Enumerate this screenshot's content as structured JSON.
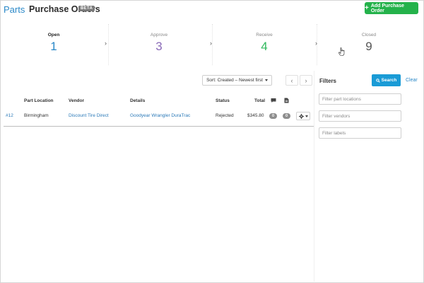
{
  "header": {
    "breadcrumb": "Parts",
    "title": "Purchase Orders",
    "beta_badge": "BETA",
    "add_button": "Add Purchase Order"
  },
  "stages": [
    {
      "label": "Open",
      "count": "1",
      "color": "#2a88c8",
      "active": true
    },
    {
      "label": "Approve",
      "count": "3",
      "color": "#8b6bb8",
      "active": false
    },
    {
      "label": "Receive",
      "count": "4",
      "color": "#2fb85c",
      "active": false
    },
    {
      "label": "Closed",
      "count": "9",
      "color": "#555555",
      "active": false
    }
  ],
  "toolbar": {
    "sort_label": "Sort: Created – Newest first",
    "prev_icon": "chevron-left-icon",
    "next_icon": "chevron-right-icon"
  },
  "table": {
    "columns": [
      "Part Location",
      "Vendor",
      "Details",
      "Status",
      "Total",
      "comment-icon",
      "document-icon"
    ],
    "rows": [
      {
        "id": "#12",
        "location": "Birmingham",
        "vendor": "Discount Tire Direct",
        "details": "Goodyear Wrangler DuraTrac",
        "status": "Rejected",
        "total": "$345.80",
        "comments": "0",
        "documents": "0"
      }
    ]
  },
  "filters": {
    "title": "Filters",
    "search_button": "Search",
    "clear_button": "Clear",
    "location_placeholder": "Filter part locations",
    "vendor_placeholder": "Filter vendors",
    "label_placeholder": "Filter labels"
  },
  "colors": {
    "accent": "#2a88c8",
    "add_button": "#24b24b",
    "search_button": "#1a9bd6"
  }
}
